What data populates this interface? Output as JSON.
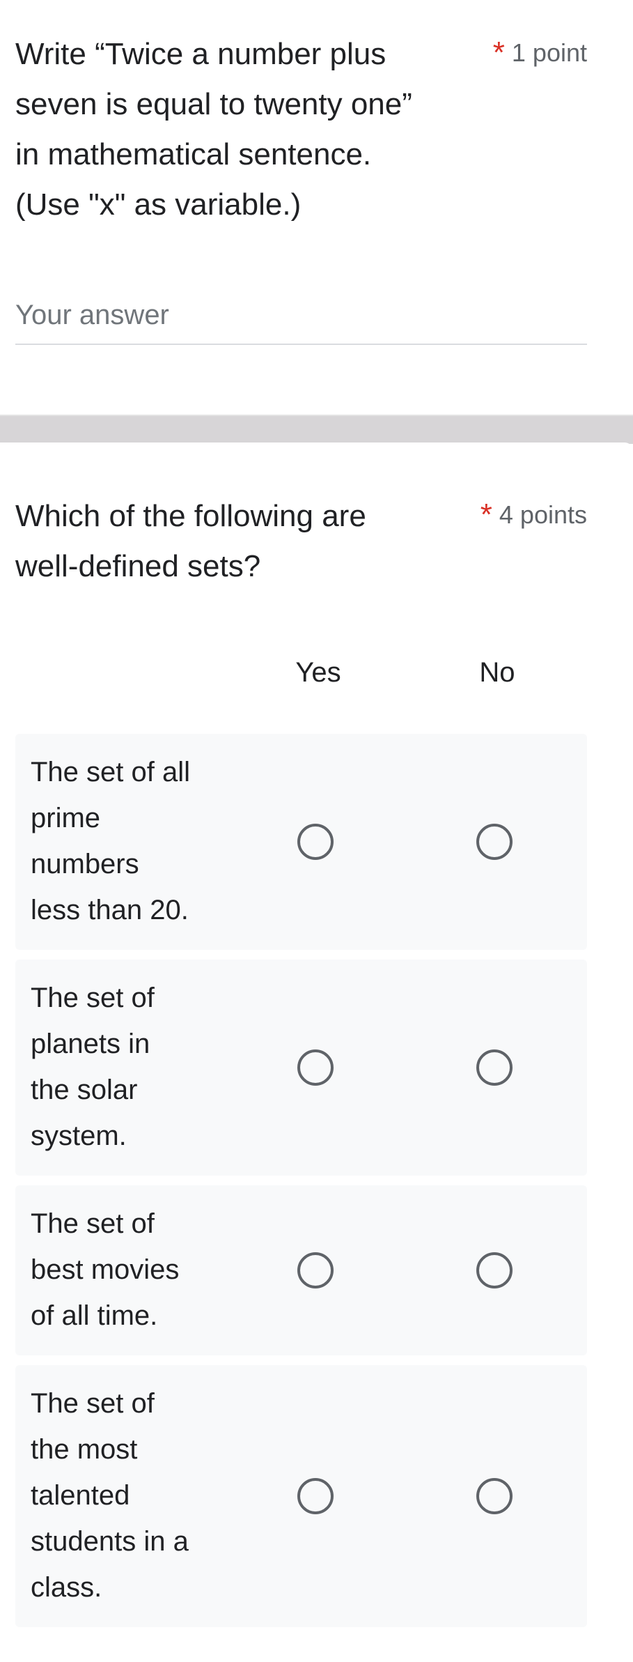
{
  "question1": {
    "title": "Write “Twice a number plus\nseven is equal to twenty one”\nin mathematical sentence.\n(Use \"x\" as variable.)",
    "required_mark": "*",
    "points": "1 point",
    "answer_placeholder": "Your answer",
    "answer_value": ""
  },
  "question2": {
    "title": "Which of the following are\nwell-defined sets?",
    "required_mark": "*",
    "points": "4 points",
    "columns": [
      "Yes",
      "No"
    ],
    "rows": [
      {
        "label": "The set of all\nprime\nnumbers\nless than 20.",
        "selected": null
      },
      {
        "label": "The set of\nplanets in\nthe solar\nsystem.",
        "selected": null
      },
      {
        "label": "The set of\nbest movies\nof all time.",
        "selected": null
      },
      {
        "label": "The set of\nthe most\ntalented\nstudents in a\nclass.",
        "selected": null
      }
    ]
  },
  "colors": {
    "required": "#d93025",
    "separator": "#d7d5d7",
    "row_background": "#f8f9fa",
    "radio_border": "#5f6368"
  }
}
